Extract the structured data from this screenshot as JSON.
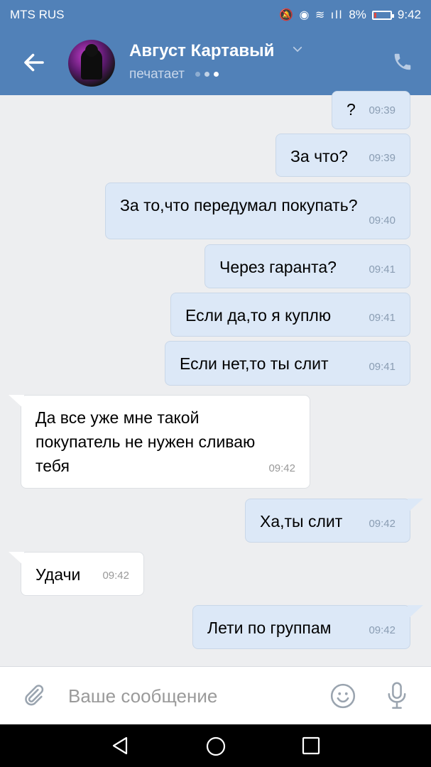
{
  "status_bar": {
    "carrier": "MTS RUS",
    "battery": "8%",
    "time": "9:42"
  },
  "header": {
    "contact_name": "Август Картавый",
    "status_text": "печатает",
    "colors": {
      "header_bg": "#5181b8",
      "out_bubble": "#dce8f7",
      "in_bubble": "#ffffff"
    }
  },
  "messages": [
    {
      "dir": "out",
      "text": "?",
      "time": "09:39"
    },
    {
      "dir": "out",
      "text": "За что?",
      "time": "09:39"
    },
    {
      "dir": "out",
      "text": "За то,что передумал покупать?",
      "time": "09:40"
    },
    {
      "dir": "out",
      "text": "Через гаранта?",
      "time": "09:41"
    },
    {
      "dir": "out",
      "text": "Если да,то я куплю",
      "time": "09:41"
    },
    {
      "dir": "out",
      "text": "Если нет,то ты слит",
      "time": "09:41"
    },
    {
      "dir": "in",
      "text": "Да все уже мне такой покупатель не нужен сливаю тебя",
      "time": "09:42"
    },
    {
      "dir": "out",
      "text": "Ха,ты слит",
      "time": "09:42"
    },
    {
      "dir": "in",
      "text": "Удачи",
      "time": "09:42"
    },
    {
      "dir": "out",
      "text": "Лети по группам",
      "time": "09:42"
    }
  ],
  "composer": {
    "placeholder": "Ваше сообщение"
  },
  "icons": {
    "back": "arrow-left-icon",
    "dropdown": "chevron-down-icon",
    "call": "phone-icon",
    "attach": "paperclip-icon",
    "emoji": "smile-icon",
    "voice": "mic-icon"
  }
}
